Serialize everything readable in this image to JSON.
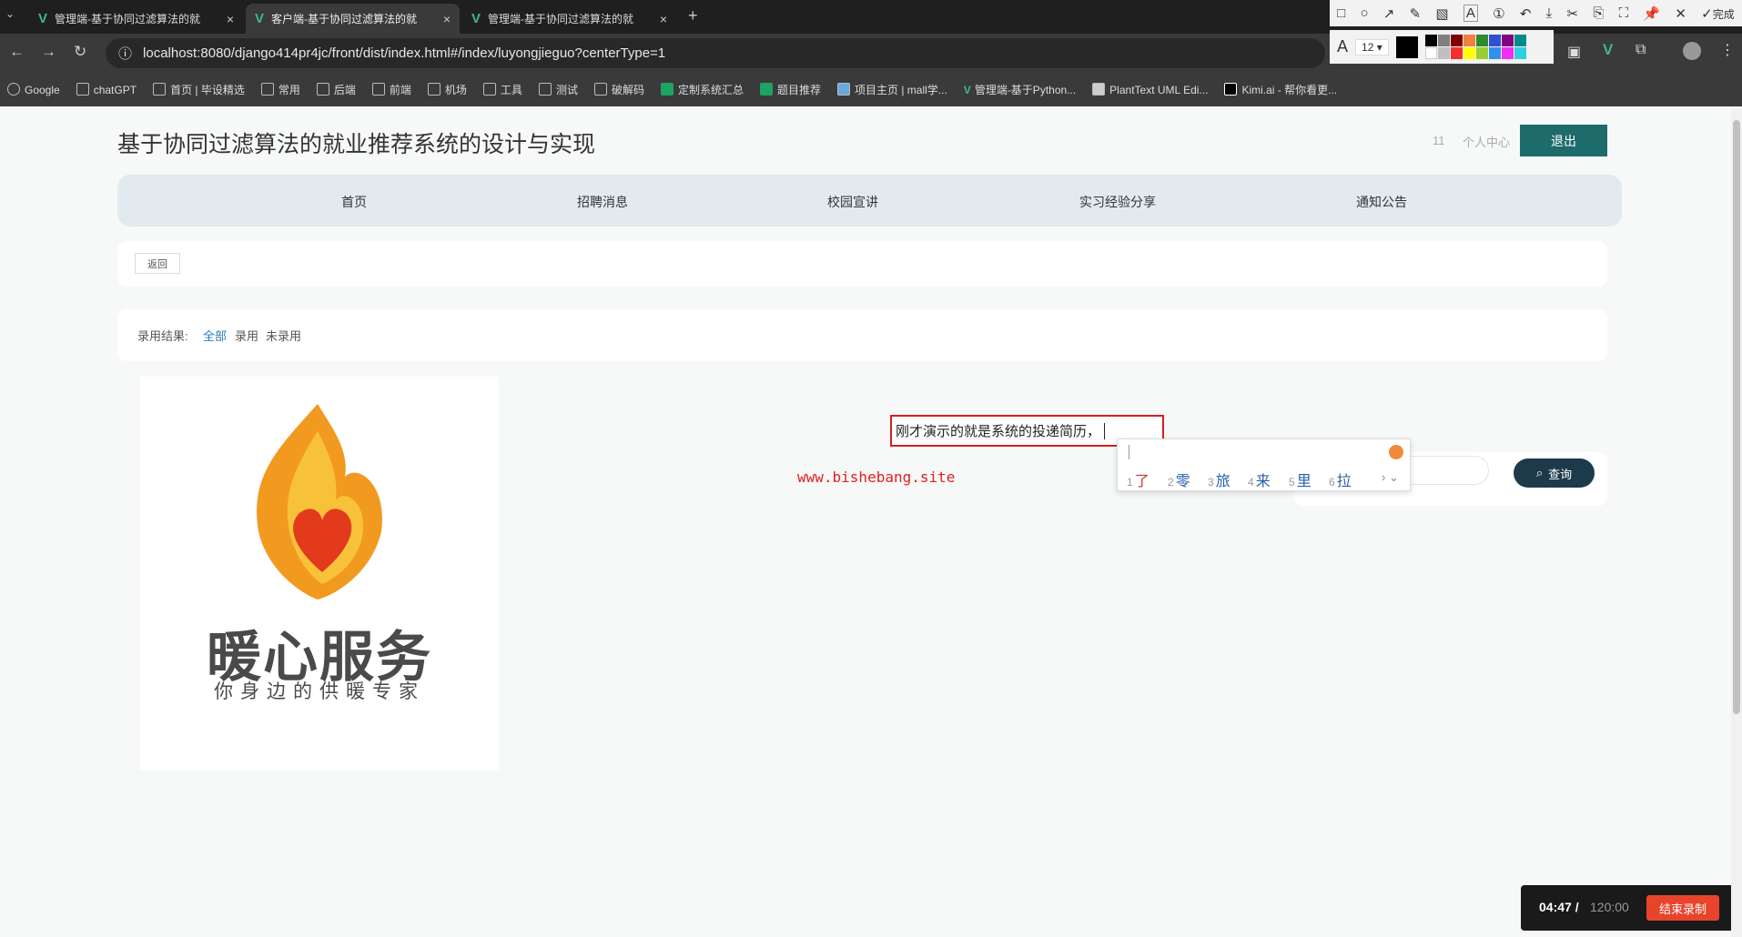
{
  "browser": {
    "tabs": [
      {
        "title": "管理端-基于协同过滤算法的就"
      },
      {
        "title": "客户端-基于协同过滤算法的就"
      },
      {
        "title": "管理端-基于协同过滤算法的就"
      }
    ],
    "url": "localhost:8080/django414pr4jc/front/dist/index.html#/index/luyongjieguo?centerType=1",
    "bookmarks": [
      "Google",
      "chatGPT",
      "首页 | 毕设精选",
      "常用",
      "后端",
      "前端",
      "机场",
      "工具",
      "测试",
      "破解码",
      "定制系统汇总",
      "题目推荐",
      "项目主页 | mall学...",
      "管理端-基于Python...",
      "PlantText UML Edi...",
      "Kimi.ai - 帮你看更..."
    ]
  },
  "snip_toolbar": {
    "done_label": "完成",
    "font_size": "12"
  },
  "header": {
    "title": "基于协同过滤算法的就业推荐系统的设计与实现",
    "user": "11",
    "center_link": "个人中心",
    "logout": "退出"
  },
  "nav": [
    "首页",
    "招聘消息",
    "校园宣讲",
    "实习经验分享",
    "通知公告"
  ],
  "back_label": "返回",
  "filter": {
    "label": "录用结果:",
    "options": [
      "全部",
      "录用",
      "未录用"
    ]
  },
  "logo": {
    "brand": "暖心服务",
    "slogan": "你身边的供暖专家"
  },
  "watermark": "www.bishebang.site",
  "annotation_text": "刚才演示的就是系统的投递简历，",
  "search": {
    "button": "查询"
  },
  "ime": {
    "candidates": [
      {
        "n": "1",
        "c": "了"
      },
      {
        "n": "2",
        "c": "零"
      },
      {
        "n": "3",
        "c": "旅"
      },
      {
        "n": "4",
        "c": "来"
      },
      {
        "n": "5",
        "c": "里"
      },
      {
        "n": "6",
        "c": "拉"
      }
    ]
  },
  "recorder": {
    "elapsed": "04:47 /",
    "total": "120:00",
    "stop": "结束录制"
  }
}
